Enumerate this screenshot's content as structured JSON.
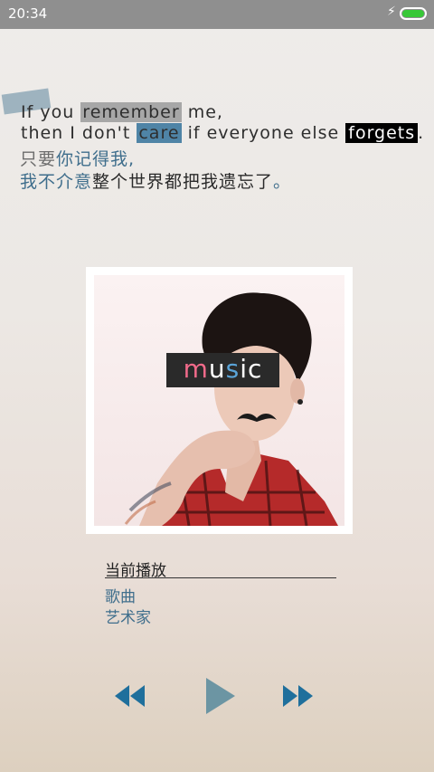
{
  "status_bar": {
    "time": "20:34",
    "battery_level": 1.0,
    "charging_icon": "lightning-icon"
  },
  "lyrics": {
    "line1": {
      "pre": "If you ",
      "highlight": "remember",
      "post": " me,"
    },
    "line2": {
      "pre": "then I don't ",
      "highlight1": "care",
      "mid": " if everyone else ",
      "highlight2": "forgets",
      "post": "."
    },
    "line3": {
      "gray": "只要",
      "blue": "你记得我,"
    },
    "line4": {
      "blue": "我不介意",
      "dark": "整个世界都把我遗忘了",
      "end": "。"
    }
  },
  "cover": {
    "label_part1": "m",
    "label_part2": "u",
    "label_part3": "s",
    "label_part4": "ic"
  },
  "now_playing": {
    "title": "当前播放",
    "song": "歌曲",
    "artist": "艺术家"
  },
  "controls": {
    "prev": "rewind-icon",
    "play": "play-icon",
    "next": "fast-forward-icon",
    "accent": "#1f6f9c"
  }
}
